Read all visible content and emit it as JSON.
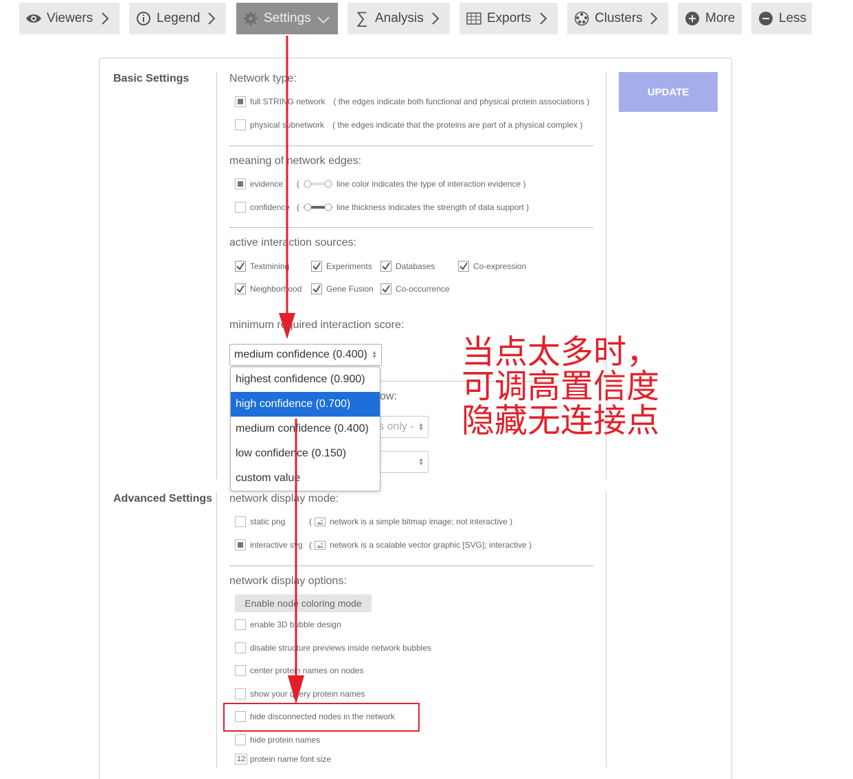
{
  "toolbar": {
    "viewers": "Viewers",
    "legend": "Legend",
    "settings": "Settings",
    "analysis": "Analysis",
    "exports": "Exports",
    "clusters": "Clusters",
    "more": "More",
    "less": "Less"
  },
  "basic": {
    "title": "Basic Settings",
    "update": "UPDATE",
    "network_type": {
      "heading": "Network type:",
      "full": "full STRING network",
      "full_desc": "( the edges indicate both functional and physical protein associations )",
      "physical": "physical subnetwork",
      "physical_desc": "( the edges indicate that the proteins are part of a physical complex )"
    },
    "edges": {
      "heading": "meaning of network edges:",
      "evidence": "evidence",
      "evidence_desc": "line color indicates the type of interaction evidence )",
      "confidence": "confidence",
      "confidence_desc": "line thickness indicates the strength of data support )",
      "open_paren": "("
    },
    "sources": {
      "heading": "active interaction sources:",
      "textmining": "Textmining",
      "experiments": "Experiments",
      "databases": "Databases",
      "coexpression": "Co-expression",
      "neighborhood": "Neighborhood",
      "gene_fusion": "Gene Fusion",
      "cooccurrence": "Co-occurrence"
    },
    "score": {
      "heading": "minimum required interaction score:",
      "selected": "medium confidence (0.400)",
      "options": [
        "highest confidence (0.900)",
        "high confidence (0.700)",
        "medium confidence (0.400)",
        "low confidence (0.150)",
        "custom value"
      ],
      "highlighted_index": 1
    },
    "max_show": {
      "heading_fragment": "ow:",
      "select_fragment": "s only -"
    }
  },
  "advanced": {
    "title": "Advanced Settings",
    "display_mode": {
      "heading": "network display mode:",
      "static": "static png",
      "static_desc": "network is a simple bitmap image; not interactive )",
      "interactive": "interactive svg",
      "interactive_desc": "network is a scalable vector graphic [SVG]; interactive )",
      "open_paren": "("
    },
    "options": {
      "heading": "network display options:",
      "coloring_button": "Enable node coloring mode",
      "bubble3d": "enable 3D bubble design",
      "disable_previews": "disable structure previews inside network bubbles",
      "center_names": "center protein names on nodes",
      "show_query": "show your query protein names",
      "hide_disconnected": "hide disconnected nodes in the network",
      "hide_names": "hide protein names",
      "font_size_value": "12",
      "font_size_label": "protein name font size"
    }
  },
  "annotation": {
    "line1": "当点太多时，",
    "line2": "可调高置信度",
    "line3": "隐藏无连接点",
    "color": "#e3202a"
  },
  "colors": {
    "update_bg": "#a6aeea",
    "selected_option_bg": "#1e6fd9",
    "active_tab_bg": "#8f8f8f"
  }
}
